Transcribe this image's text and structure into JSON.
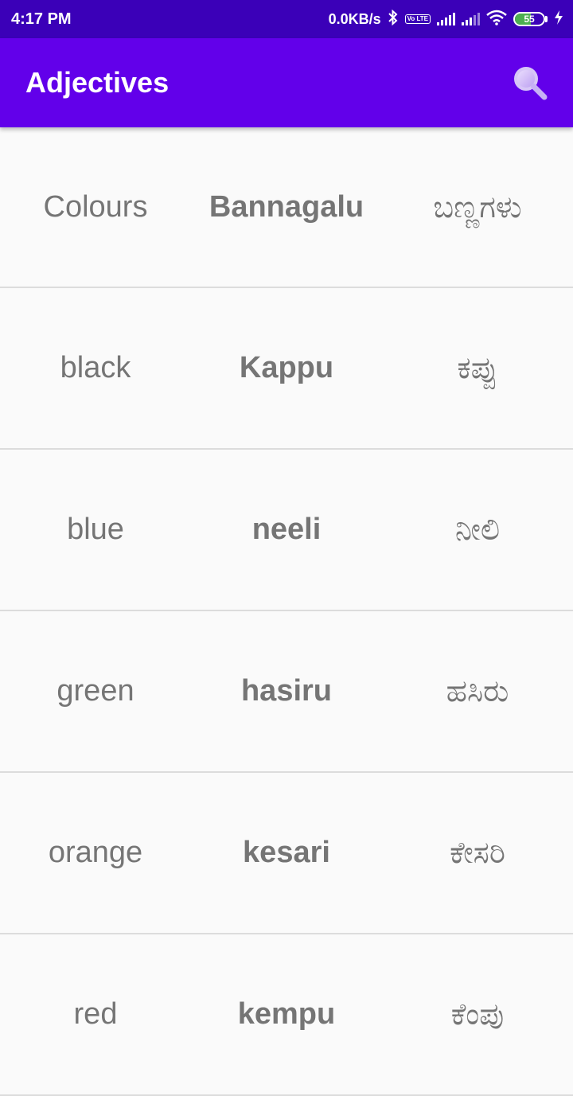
{
  "status_bar": {
    "time": "4:17 PM",
    "network_speed": "0.0KB/s",
    "volte_label": "Vo LTE",
    "battery_level": "55",
    "icons": [
      "bluetooth-icon",
      "volte-icon",
      "signal-icon",
      "signal-icon",
      "wifi-icon",
      "battery-icon",
      "charging-icon"
    ]
  },
  "app_bar": {
    "title": "Adjectives",
    "search_icon": "search-icon",
    "color": "#6200ea"
  },
  "words": [
    {
      "english": "Colours",
      "transliteration": "Bannagalu",
      "kannada": "ಬಣ್ಣಗಳು"
    },
    {
      "english": "black",
      "transliteration": "Kappu",
      "kannada": "ಕಪ್ಪು"
    },
    {
      "english": "blue",
      "transliteration": "neeli",
      "kannada": "ನೀಲಿ"
    },
    {
      "english": "green",
      "transliteration": "hasiru",
      "kannada": "ಹಸಿರು"
    },
    {
      "english": "orange",
      "transliteration": "kesari",
      "kannada": "ಕೇಸರಿ"
    },
    {
      "english": "red",
      "transliteration": "kempu",
      "kannada": "ಕೆಂಪು"
    }
  ]
}
